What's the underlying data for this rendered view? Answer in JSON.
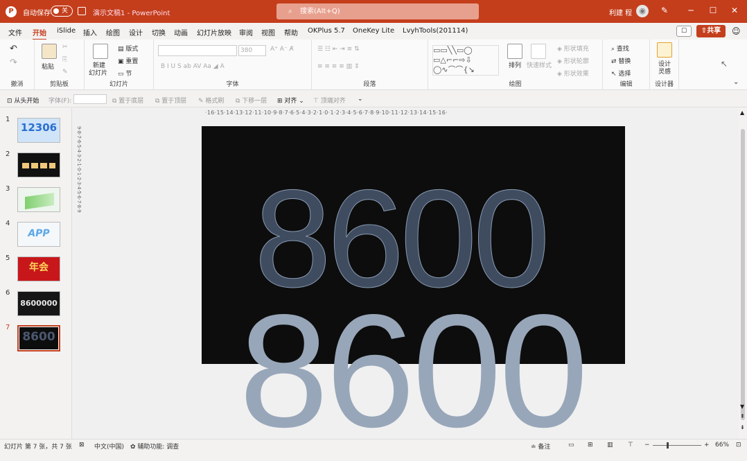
{
  "titlebar": {
    "autosave_label": "自动保存",
    "autosave_state": "关",
    "doc_name": "演示文稿1",
    "separator": "-",
    "app_name": "PowerPoint",
    "search_placeholder": "搜索(Alt+Q)",
    "user_name": "利建 程"
  },
  "tabs": [
    "文件",
    "开始",
    "iSlide",
    "插入",
    "绘图",
    "设计",
    "切换",
    "动画",
    "幻灯片放映",
    "审阅",
    "视图",
    "帮助",
    "OKPlus 5.7",
    "OneKey Lite",
    "LvyhTools(201114)"
  ],
  "active_tab": "开始",
  "share_label": "共享",
  "ribbon": {
    "undo": {
      "label": "撤消"
    },
    "clipboard": {
      "label": "剪贴板",
      "paste": "粘贴"
    },
    "slides": {
      "label": "幻灯片",
      "new_slide": "新建",
      "new_slide2": "幻灯片",
      "layout": "版式",
      "reset": "重置",
      "section": "节"
    },
    "font": {
      "label": "字体",
      "size": "380"
    },
    "paragraph": {
      "label": "段落"
    },
    "drawing": {
      "label": "绘图",
      "arrange": "排列",
      "quick_styles": "快速样式",
      "fill": "形状填充",
      "outline": "形状轮廓",
      "effects": "形状效果"
    },
    "editing": {
      "label": "编辑",
      "find": "查找",
      "replace": "替换",
      "select": "选择"
    },
    "designer": {
      "label": "设计器",
      "design": "设计",
      "ideas": "灵感"
    }
  },
  "qat": {
    "from_start": "从头开始",
    "font_label": "字体(F):",
    "bring_front": "置于底层",
    "send_top": "置于顶层",
    "format_painter": "格式刷",
    "move_down": "下移一层",
    "align": "对齐",
    "top_align": "顶端对齐"
  },
  "ruler_h": "·16·15·14·13·12·11·10·9·8·7·6·5·4·3·2·1·0·1·2·3·4·5·6·7·8·9·10·11·12·13·14·15·16·",
  "ruler_v": "9·8·7·6·5·4·3·2·1·0·1·2·3·4·5·6·7·8·9",
  "slides": [
    {
      "num": "1",
      "text": "12306"
    },
    {
      "num": "2",
      "text": ""
    },
    {
      "num": "3",
      "text": ""
    },
    {
      "num": "4",
      "text": "APP"
    },
    {
      "num": "5",
      "text": "年会"
    },
    {
      "num": "6",
      "text": "8600000"
    },
    {
      "num": "7",
      "text": "8600"
    }
  ],
  "current_slide": {
    "number_top": "8600",
    "number_bottom": "8600"
  },
  "status": {
    "slide_info": "幻灯片 第 7 张，共 7 张",
    "language": "中文(中国)",
    "accessibility": "辅助功能: 调查",
    "notes": "备注",
    "zoom": "66%"
  }
}
